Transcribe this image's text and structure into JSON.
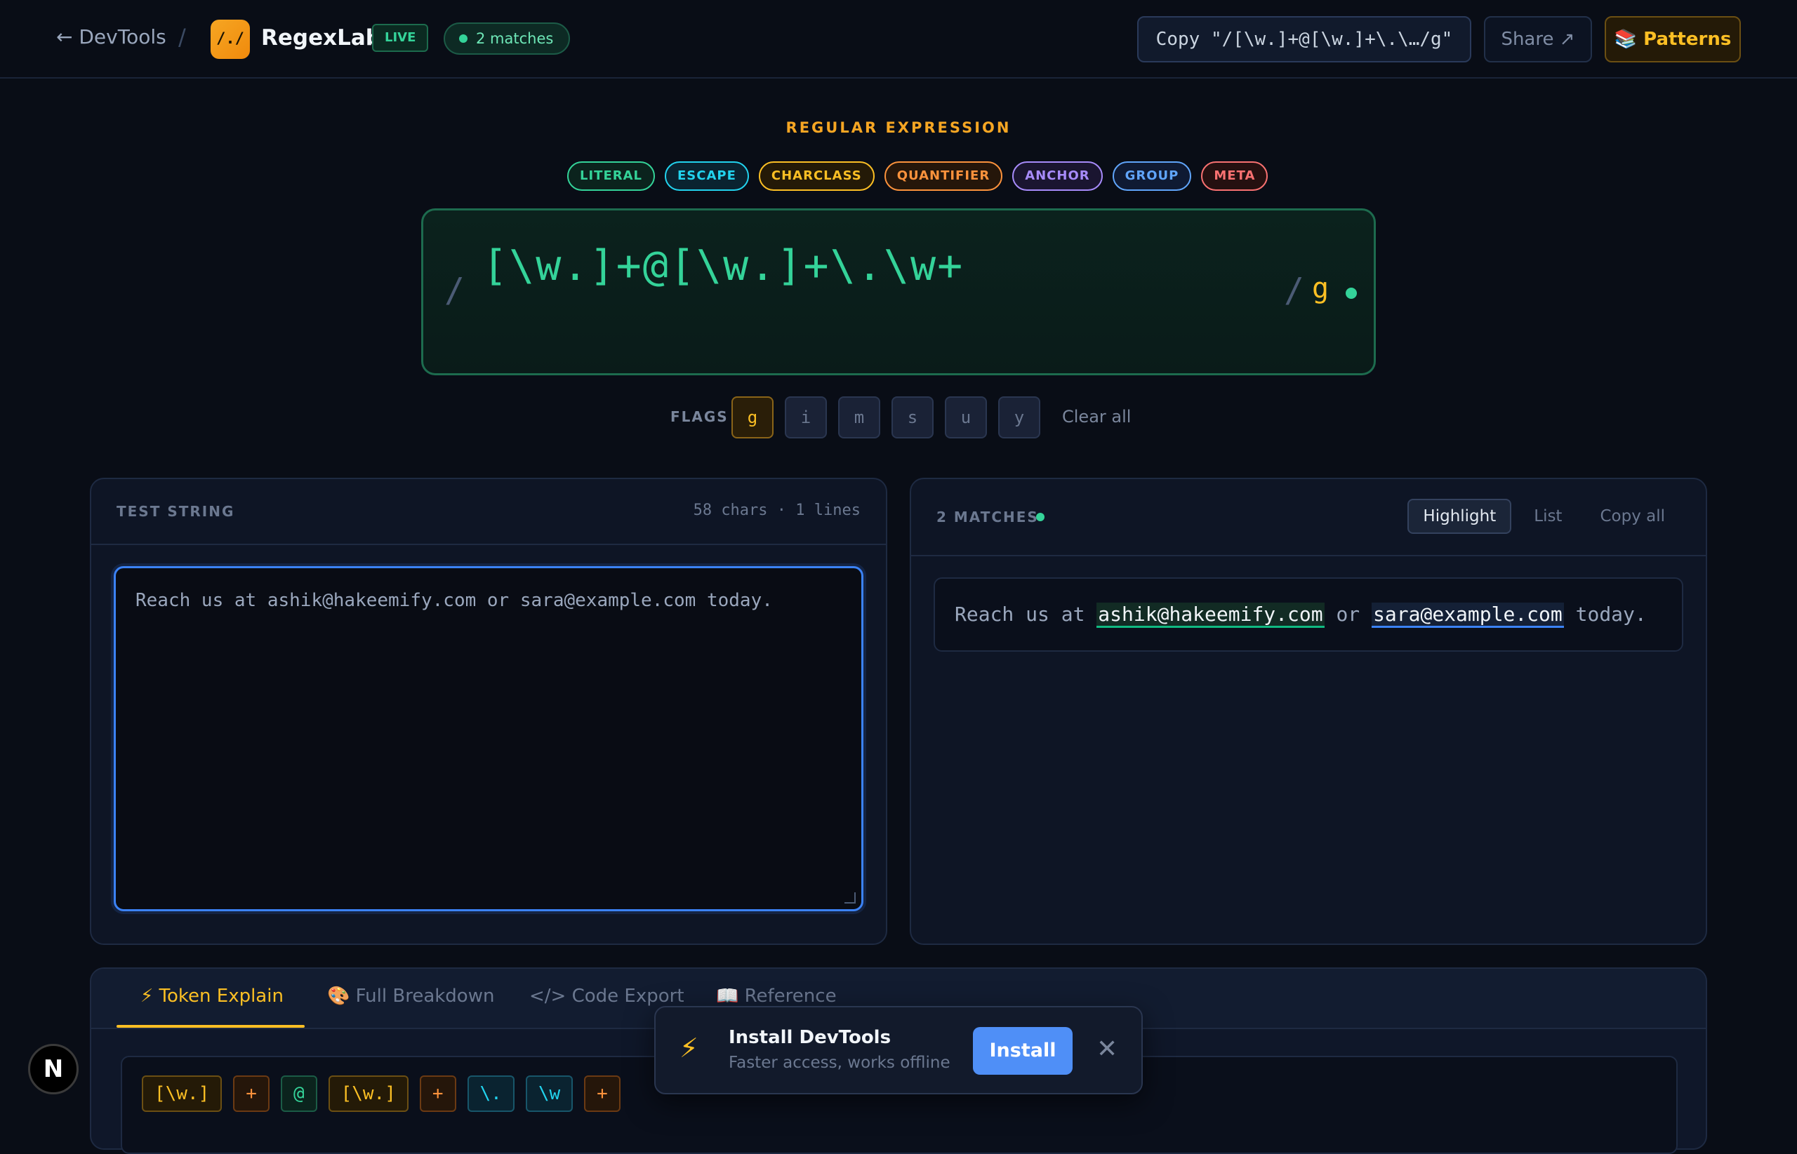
{
  "header": {
    "back_label": "← DevTools",
    "separator": "/",
    "logo_text": "/./",
    "app_title": "RegexLab",
    "live_badge": "LIVE",
    "match_count": "2 matches",
    "copy_label": "Copy \"/[\\w.]+@[\\w.]+\\.\\…/g\"",
    "share_label": "Share ↗",
    "patterns_label": "📚 Patterns"
  },
  "regex": {
    "section_label": "REGULAR EXPRESSION",
    "legend": [
      "LITERAL",
      "ESCAPE",
      "CHARCLASS",
      "QUANTIFIER",
      "ANCHOR",
      "GROUP",
      "META"
    ],
    "delimiter_open": "/",
    "pattern": "[\\w.]+@[\\w.]+\\.\\w+",
    "delimiter_close": "/",
    "flags_suffix": "g",
    "flags_label": "FLAGS",
    "flags": [
      {
        "flag": "g",
        "active": true
      },
      {
        "flag": "i",
        "active": false
      },
      {
        "flag": "m",
        "active": false
      },
      {
        "flag": "s",
        "active": false
      },
      {
        "flag": "u",
        "active": false
      },
      {
        "flag": "y",
        "active": false
      }
    ],
    "clear_all": "Clear all"
  },
  "test_panel": {
    "title": "TEST STRING",
    "meta": "58 chars · 1 lines",
    "value": "Reach us at ashik@hakeemify.com or sara@example.com today."
  },
  "results_panel": {
    "title": "2 MATCHES",
    "views": [
      "Highlight",
      "List",
      "Copy all"
    ],
    "active_view": "Highlight",
    "segments": {
      "pre": "Reach us at ",
      "match1": "ashik@hakeemify.com",
      "mid": " or ",
      "match2": "sara@example.com",
      "post": " today."
    }
  },
  "bottom_tabs": {
    "tabs": [
      "⚡ Token Explain",
      "🎨 Full Breakdown",
      "</> Code Export",
      "📖 Reference"
    ],
    "active_tab": "⚡ Token Explain",
    "tokens": [
      {
        "text": "[\\w.]",
        "kind": "charclass"
      },
      {
        "text": "+",
        "kind": "quantifier"
      },
      {
        "text": "@",
        "kind": "literal"
      },
      {
        "text": "[\\w.]",
        "kind": "charclass"
      },
      {
        "text": "+",
        "kind": "quantifier"
      },
      {
        "text": "\\.",
        "kind": "escape"
      },
      {
        "text": "\\w",
        "kind": "escape"
      },
      {
        "text": "+",
        "kind": "quantifier"
      }
    ]
  },
  "toast": {
    "icon": "⚡",
    "title": "Install DevTools",
    "subtitle": "Faster access, works offline",
    "install_label": "Install",
    "close_icon": "✕"
  },
  "corner_badge": "N"
}
